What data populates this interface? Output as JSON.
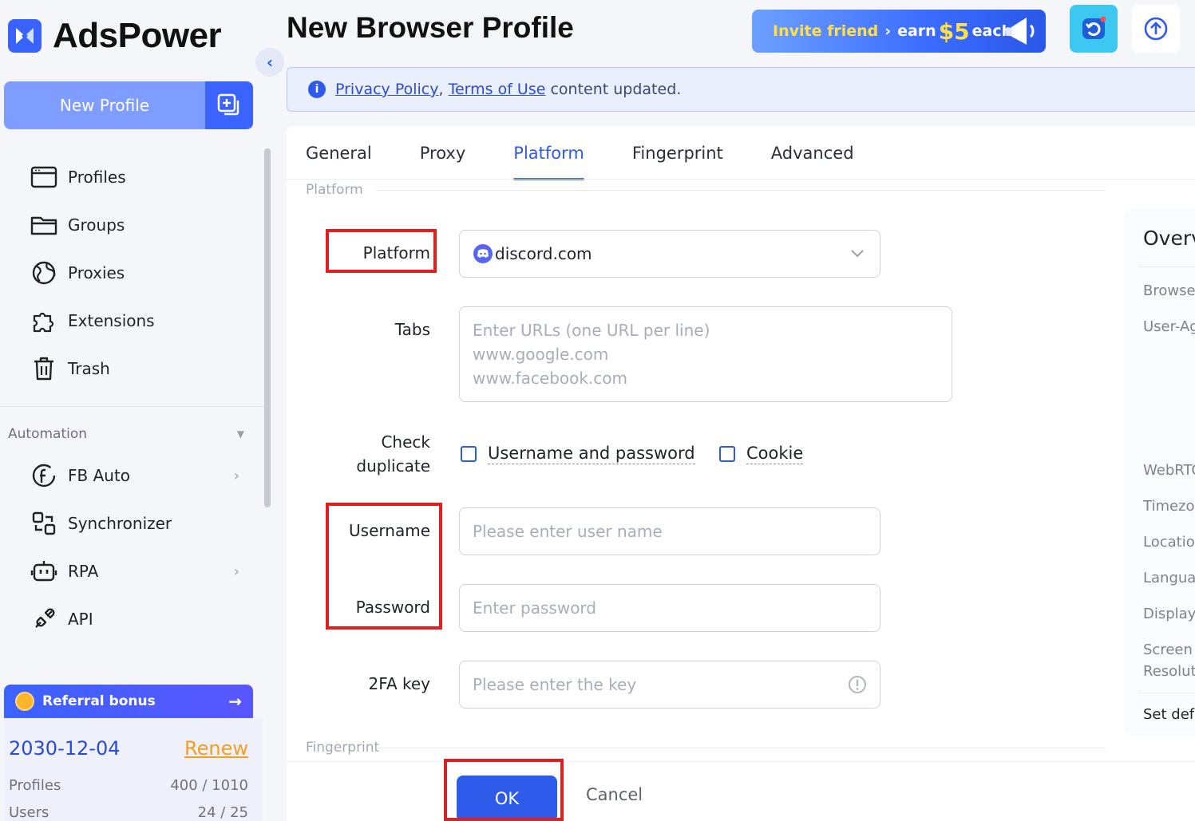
{
  "app": {
    "name": "AdsPower"
  },
  "sidebar": {
    "new_profile_label": "New Profile",
    "nav": [
      {
        "label": "Profiles",
        "icon": "profiles-icon"
      },
      {
        "label": "Groups",
        "icon": "folder-icon"
      },
      {
        "label": "Proxies",
        "icon": "globe-icon"
      },
      {
        "label": "Extensions",
        "icon": "puzzle-icon"
      },
      {
        "label": "Trash",
        "icon": "trash-icon"
      }
    ],
    "automation_title": "Automation",
    "automation": [
      {
        "label": "FB Auto",
        "icon": "facebook-icon"
      },
      {
        "label": "Synchronizer",
        "icon": "sync-icon"
      },
      {
        "label": "RPA",
        "icon": "robot-icon"
      },
      {
        "label": "API",
        "icon": "plug-icon"
      }
    ],
    "referral_label": "Referral bonus",
    "plan": {
      "date": "2030-12-04",
      "renew": "Renew",
      "profiles_label": "Profiles",
      "profiles_value": "400 / 1010",
      "users_label": "Users",
      "users_value": "24 / 25"
    }
  },
  "header": {
    "title": "New Browser Profile",
    "invite": {
      "part1": "Invite friend",
      "arrow": "›",
      "part2": "earn",
      "amount": "$5",
      "part3": "each"
    }
  },
  "notice": {
    "link1": "Privacy Policy",
    "sep": ", ",
    "link2": "Terms of Use",
    "rest": " content updated."
  },
  "tabs": [
    "General",
    "Proxy",
    "Platform",
    "Fingerprint",
    "Advanced"
  ],
  "active_tab": "Platform",
  "form": {
    "section_platform": "Platform",
    "section_fingerprint": "Fingerprint",
    "platform_label": "Platform",
    "platform_value": "discord.com",
    "tabs_label": "Tabs",
    "tabs_placeholder": [
      "Enter URLs (one URL per line)",
      "www.google.com",
      "www.facebook.com"
    ],
    "check_label_1": "Check",
    "check_label_2": "duplicate",
    "check_option_1": "Username and password",
    "check_option_2": "Cookie",
    "username_label": "Username",
    "username_placeholder": "Please enter user name",
    "password_label": "Password",
    "password_placeholder": "Enter password",
    "twofa_label": "2FA key",
    "twofa_placeholder": "Please enter the key"
  },
  "overview": {
    "title": "Overv",
    "items": [
      "Browse",
      "User-Ag",
      "WebRTC",
      "Timezo",
      "Locatio",
      "Langua",
      "Display",
      "Screen",
      "Resoluti"
    ],
    "set_default": "Set defa"
  },
  "footer": {
    "ok": "OK",
    "cancel": "Cancel"
  },
  "colors": {
    "accent": "#2f5bea",
    "highlight": "#e02020",
    "warning": "#f0a020"
  }
}
